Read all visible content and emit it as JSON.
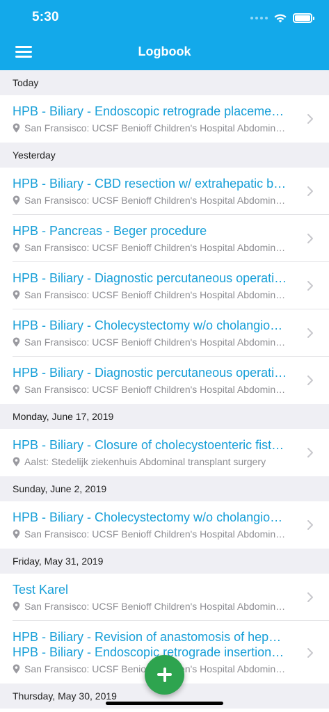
{
  "status_bar": {
    "time": "5:30",
    "wifi_icon": "wifi-icon",
    "battery_icon": "battery-icon"
  },
  "nav": {
    "title": "Logbook",
    "menu_icon": "hamburger-menu-icon"
  },
  "sections": [
    {
      "header": "Today",
      "rows": [
        {
          "title": "HPB - Biliary - Endoscopic retrograde placement of stent",
          "location": "San Fransisco: UCSF Benioff Children's Hospital Abdominal transplant surgery"
        }
      ]
    },
    {
      "header": "Yesterday",
      "rows": [
        {
          "title": "HPB - Biliary - CBD resection w/ extrahepatic biliary reconstruction",
          "location": "San Fransisco: UCSF Benioff Children's Hospital Abdominal transplant surgery"
        },
        {
          "title": "HPB - Pancreas - Beger procedure",
          "location": "San Fransisco: UCSF Benioff Children's Hospital Abdominal transplant surgery"
        },
        {
          "title": "HPB - Biliary - Diagnostic percutaneous operative cholangiography",
          "location": "San Fransisco: UCSF Benioff Children's Hospital Abdominal transplant surgery"
        },
        {
          "title": "HPB - Biliary - Cholecystectomy w/o  cholangiography",
          "location": "San Fransisco: UCSF Benioff Children's Hospital Abdominal transplant surgery"
        },
        {
          "title": "HPB - Biliary - Diagnostic percutaneous operative cholangiography",
          "location": "San Fransisco: UCSF Benioff Children's Hospital Abdominal transplant surgery"
        }
      ]
    },
    {
      "header": "Monday, June 17, 2019",
      "rows": [
        {
          "title": "HPB - Biliary - Closure of cholecystoenteric fistula",
          "location": "Aalst: Stedelijk ziekenhuis Abdominal transplant surgery"
        }
      ]
    },
    {
      "header": "Sunday, June 2, 2019",
      "rows": [
        {
          "title": "HPB - Biliary - Cholecystectomy w/o  cholangiography",
          "location": "San Fransisco: UCSF Benioff Children's Hospital Abdominal transplant surgery"
        }
      ]
    },
    {
      "header": "Friday, May 31, 2019",
      "rows": [
        {
          "title": "Test Karel",
          "location": "San Fransisco: UCSF Benioff Children's Hospital Abdominal transplant surgery"
        },
        {
          "title": "HPB - Biliary - Revision of anastomosis of hepaticojejunostomy",
          "title2": "HPB - Biliary - Endoscopic retrograde insertion of stent",
          "location": "San Fransisco: UCSF Benioff Children's Hospital Abdominal transplant surgery"
        }
      ]
    },
    {
      "header": "Thursday, May 30, 2019",
      "rows": []
    }
  ],
  "fab": {
    "icon": "plus-icon"
  },
  "colors": {
    "primary": "#13a9ea",
    "title_text": "#179fd8",
    "fab": "#2ea44f",
    "section_bg": "#efeff4"
  }
}
